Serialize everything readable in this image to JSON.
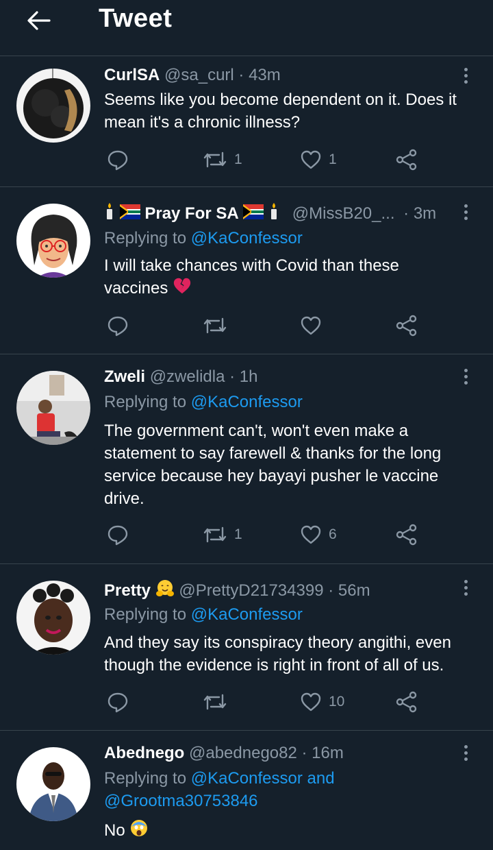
{
  "header": {
    "title": "Tweet"
  },
  "tweets": [
    {
      "name": "CurlSA",
      "handle": "@sa_curl",
      "time": "· 43m",
      "replying_label": "",
      "replying_to": "",
      "text_lines": [
        "Seems like you become dependent on it. Does it",
        "mean it's a chronic illness?"
      ],
      "retweets": "1",
      "likes": "1"
    },
    {
      "name": "Pray For SA",
      "handle": "@MissB20_...",
      "time": "· 3m",
      "replying_label": "Replying to",
      "replying_to": "@KaConfessor",
      "text_lines": [
        "I will take chances with Covid than these",
        "vaccines"
      ],
      "retweets": "",
      "likes": ""
    },
    {
      "name": "Zweli",
      "handle": "@zwelidla",
      "time": "· 1h",
      "replying_label": "Replying to",
      "replying_to": "@KaConfessor",
      "text_lines": [
        "The government can't, won't even make a",
        "statement to say farewell & thanks for the long",
        "service because hey bayayi pusher le vaccine",
        "drive."
      ],
      "retweets": "1",
      "likes": "6"
    },
    {
      "name": "Pretty",
      "handle": "@PrettyD21734399",
      "time": "· 56m",
      "replying_label": "Replying to",
      "replying_to": "@KaConfessor",
      "text_lines": [
        "And they say its conspiracy theory angithi, even",
        "though the evidence is right in front of all of us."
      ],
      "retweets": "",
      "likes": "10"
    },
    {
      "name": "Abednego",
      "handle": "@abednego82",
      "time": "· 16m",
      "replying_label": "Replying to",
      "replying_to": "@KaConfessor and",
      "replying_to_2": "@Grootma30753846",
      "text_lines": [
        "No"
      ],
      "retweets": "",
      "likes": ""
    }
  ],
  "icons": {
    "back": "arrow-left-icon",
    "reply": "reply-bubble-icon",
    "retweet": "retweet-icon",
    "like": "heart-icon",
    "share": "share-icon",
    "more": "vertical-dots-icon"
  },
  "colors": {
    "background": "#15202b",
    "divider": "#38444d",
    "muted": "#8b98a5",
    "link": "#1d9bf0"
  }
}
